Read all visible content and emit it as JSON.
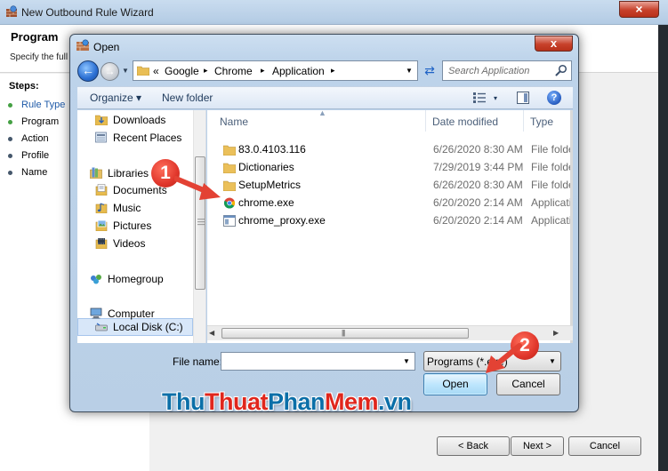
{
  "wizard": {
    "title": "New Outbound Rule Wizard",
    "close_glyph": "×",
    "header_title": "Program",
    "header_subtitle": "Specify the full p",
    "steps_label": "Steps:",
    "steps": [
      {
        "label": "Rule Type",
        "state": "done"
      },
      {
        "label": "Program",
        "state": "current"
      },
      {
        "label": "Action",
        "state": "todo"
      },
      {
        "label": "Profile",
        "state": "todo"
      },
      {
        "label": "Name",
        "state": "todo"
      }
    ],
    "back_label": "< Back",
    "next_label": "Next >",
    "cancel_label": "Cancel"
  },
  "dialog": {
    "title": "Open",
    "close_glyph": "x",
    "breadcrumb": {
      "overflow": "«",
      "items": [
        "Google",
        "Chrome",
        "Application"
      ],
      "sep": "▸"
    },
    "search_placeholder": "Search Application",
    "toolbar": {
      "organize_label": "Organize ▾",
      "new_folder_label": "New folder",
      "views_drop": "▾",
      "help_glyph": "?"
    },
    "nav": {
      "items": [
        {
          "label": "Downloads",
          "icon": "downloads-icon"
        },
        {
          "label": "Recent Places",
          "icon": "recent-places-icon"
        },
        {
          "label": "Libraries",
          "icon": "libraries-icon"
        },
        {
          "label": "Documents",
          "icon": "documents-icon"
        },
        {
          "label": "Music",
          "icon": "music-icon"
        },
        {
          "label": "Pictures",
          "icon": "pictures-icon"
        },
        {
          "label": "Videos",
          "icon": "videos-icon"
        },
        {
          "label": "Homegroup",
          "icon": "homegroup-icon"
        },
        {
          "label": "Computer",
          "icon": "computer-icon"
        },
        {
          "label": "Local Disk (C:)",
          "icon": "local-disk-icon"
        }
      ]
    },
    "columns": {
      "name": "Name",
      "date": "Date modified",
      "type": "Type"
    },
    "files": [
      {
        "name": "83.0.4103.116",
        "date": "6/26/2020 8:30 AM",
        "type": "File folder",
        "icon": "folder-icon"
      },
      {
        "name": "Dictionaries",
        "date": "7/29/2019 3:44 PM",
        "type": "File folder",
        "icon": "folder-icon"
      },
      {
        "name": "SetupMetrics",
        "date": "6/26/2020 8:30 AM",
        "type": "File folder",
        "icon": "folder-icon"
      },
      {
        "name": "chrome.exe",
        "date": "6/20/2020 2:14 AM",
        "type": "Application",
        "icon": "chrome-icon"
      },
      {
        "name": "chrome_proxy.exe",
        "date": "6/20/2020 2:14 AM",
        "type": "Application",
        "icon": "exe-icon"
      }
    ],
    "file_name_label": "File name:",
    "file_name_value": "",
    "file_type_value": "Programs (*.exe)",
    "open_label": "Open",
    "cancel_label": "Cancel"
  },
  "annotations": {
    "badge1": "1",
    "badge2": "2",
    "watermark": {
      "thu": "Thu",
      "thuat": "Thuat",
      "phan": "Phan",
      "mem": "Mem",
      "vn": ".vn"
    },
    "colors": {
      "badge": "#e0362b",
      "arrow": "#e34234",
      "wm_dark": "#0b6fa8",
      "wm_red": "#e0261c"
    }
  }
}
